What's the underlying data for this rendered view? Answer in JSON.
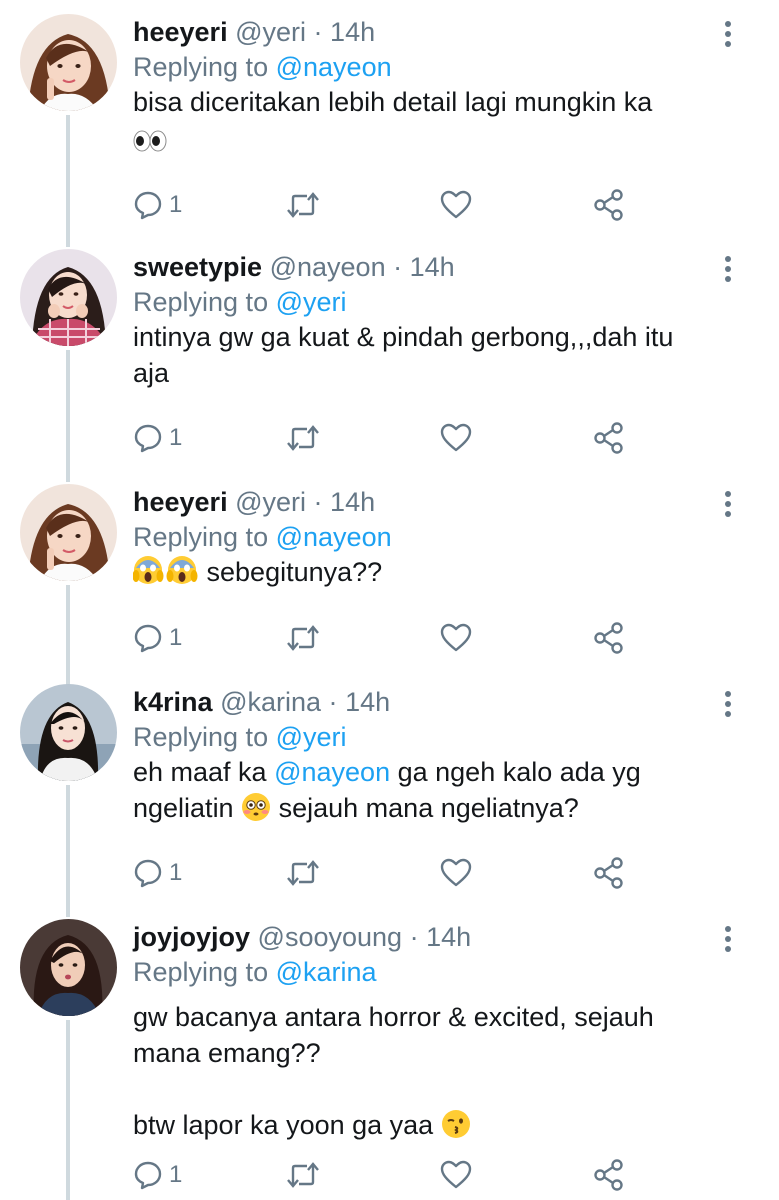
{
  "colors": {
    "link": "#1da1f2",
    "muted": "#657786",
    "text": "#14171a",
    "thread_line": "#cfd9de"
  },
  "tweets": [
    {
      "name": "heeyeri",
      "handle": "@yeri",
      "time": "14h",
      "replying_label": "Replying to",
      "replying_to": "@nayeon",
      "body_text": "bisa diceritakan lebih detail lagi mungkin ka",
      "emoji": "eyes-emoji",
      "reply_count": "1"
    },
    {
      "name": "sweetypie",
      "handle": "@nayeon",
      "time": "14h",
      "replying_label": "Replying to",
      "replying_to": "@yeri",
      "body_line1": "intinya gw ga kuat & pindah gerbong,,,dah itu",
      "body_line2": "aja",
      "reply_count": "1"
    },
    {
      "name": "heeyeri",
      "handle": "@yeri",
      "time": "14h",
      "replying_label": "Replying to",
      "replying_to": "@nayeon",
      "emoji": "face-screaming-in-fear-emoji",
      "body_text": "sebegitunya??",
      "reply_count": "1"
    },
    {
      "name": "k4rina",
      "handle": "@karina",
      "time": "14h",
      "replying_label": "Replying to",
      "replying_to": "@yeri",
      "body_pre": "eh maaf ka",
      "body_mention": "@nayeon",
      "body_post": "ga ngeh kalo ada yg",
      "body_line2_pre": "ngeliatin",
      "emoji": "flushed-face-emoji",
      "body_line2_post": "sejauh mana ngeliatnya?",
      "reply_count": "1"
    },
    {
      "name": "joyjoyjoy",
      "handle": "@sooyoung",
      "time": "14h",
      "replying_label": "Replying to",
      "replying_to": "@karina",
      "body_line1": "gw bacanya antara horror & excited, sejauh",
      "body_line2": "mana emang??",
      "body_line3": "btw lapor ka yoon ga yaa",
      "emoji": "kissing-face-emoji",
      "reply_count": "1"
    }
  ],
  "separator": "·"
}
